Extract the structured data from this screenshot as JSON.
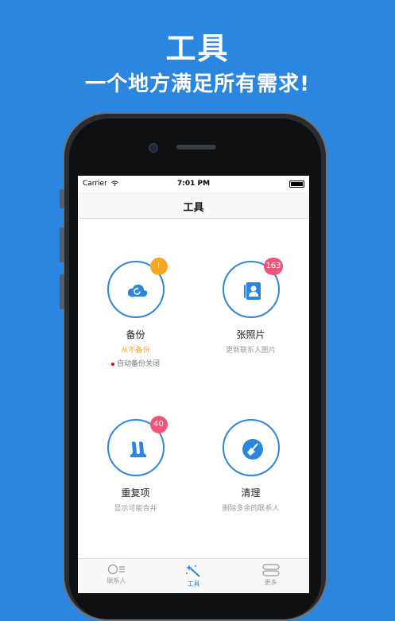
{
  "promo": {
    "title": "工具",
    "subtitle": "一个地方满足所有需求!"
  },
  "status_bar": {
    "carrier": "Carrier",
    "time": "7:01 PM"
  },
  "nav": {
    "title": "工具"
  },
  "tools": [
    {
      "label": "备份",
      "badge": "!",
      "status": "从不备份",
      "note": "自动备份关闭",
      "icon": "cloud-sync-icon"
    },
    {
      "label": "张照片",
      "badge": "163",
      "status": "更新联系人图片",
      "icon": "contact-photo-icon"
    },
    {
      "label": "重复项",
      "badge": "40",
      "status": "显示可能合并",
      "icon": "duplicates-icon"
    },
    {
      "label": "清理",
      "status": "删除多余的联系人",
      "icon": "broom-icon"
    }
  ],
  "tabs": [
    {
      "label": "联系人",
      "icon": "contacts-tab-icon"
    },
    {
      "label": "工具",
      "icon": "magic-wand-icon",
      "active": true
    },
    {
      "label": "更多",
      "icon": "more-toggles-icon"
    }
  ],
  "colors": {
    "background": "#2b86df",
    "accent": "#2b86df",
    "warning": "#f5a623",
    "badge": "#f0527a"
  }
}
